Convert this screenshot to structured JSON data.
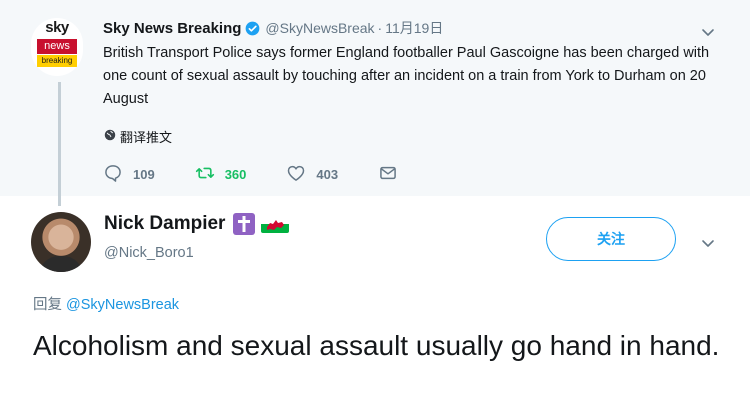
{
  "parent_tweet": {
    "logo": {
      "word": "sky",
      "bar1": "news",
      "bar2": "breaking"
    },
    "author_name": "Sky News Breaking",
    "handle": "@SkyNewsBreak",
    "separator": "·",
    "time": "11月19日",
    "text": "British Transport Police says former England footballer Paul Gascoigne has been charged with one count of sexual assault by touching after an incident on a train from York to Durham on 20 August",
    "translate_label": "翻译推文",
    "actions": {
      "reply_count": "109",
      "retweet_count": "360",
      "like_count": "403"
    },
    "icons": [
      "verified-icon",
      "chevron-down-icon",
      "globe-icon",
      "reply-icon",
      "retweet-icon",
      "like-icon",
      "direct-message-icon"
    ]
  },
  "reply_tweet": {
    "author_name": "Nick Dampier",
    "handle": "@Nick_Boro1",
    "follow_label": "关注",
    "reply_prefix": "回复",
    "reply_mention": "@SkyNewsBreak",
    "text": "Alcoholism and sexual assault usually go hand in hand.",
    "icons": [
      "latin-cross-emoji-icon",
      "wales-flag-icon",
      "chevron-down-icon"
    ]
  },
  "colors": {
    "accent": "#1da1f2",
    "retweet": "#17bf63",
    "muted": "#657786",
    "parent_background": "#f5f8fa"
  }
}
